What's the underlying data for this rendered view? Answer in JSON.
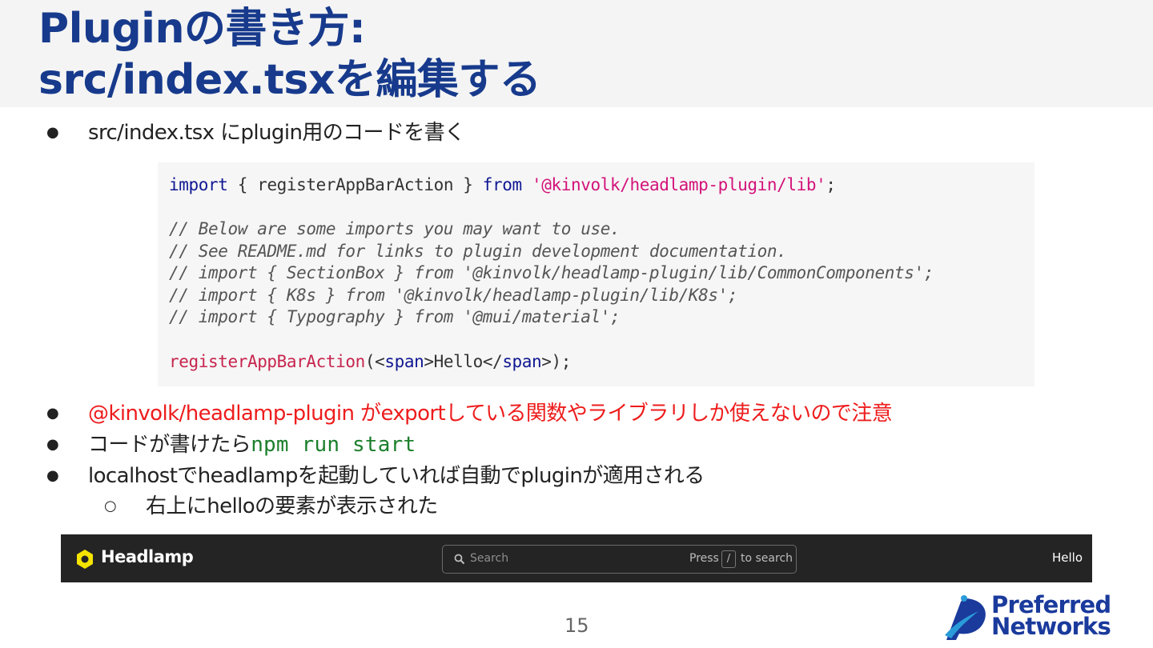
{
  "title": {
    "line1": "Pluginの書き方:",
    "line2": "src/index.tsxを編集する"
  },
  "bullets": {
    "b1": "src/index.tsx にplugin用のコードを書く",
    "b2": "@kinvolk/headlamp-plugin がexportしている関数やライブラリしか使えないので注意",
    "b3_text": "コードが書けたら",
    "b3_code": "npm run start",
    "b4": "localhostでheadlampを起動していれば自動でpluginが適用される",
    "b5": "右上にhelloの要素が表示された",
    "dot": "●",
    "sub_dot": "○"
  },
  "code": {
    "l1": {
      "kw1": "import",
      "p1": " { registerAppBarAction } ",
      "kw2": "from",
      "p2": " ",
      "str": "'@kinvolk/headlamp-plugin/lib'",
      "p3": ";"
    },
    "l3": "// Below are some imports you may want to use.",
    "l4": "//   See README.md for links to plugin development documentation.",
    "l5": "// import { SectionBox } from '@kinvolk/headlamp-plugin/lib/CommonComponents';",
    "l6": "// import { K8s } from '@kinvolk/headlamp-plugin/lib/K8s';",
    "l7": "// import { Typography } from '@mui/material';",
    "l9": {
      "fn": "registerAppBarAction",
      "p1": "(<",
      "tag1": "span",
      "p2": ">Hello</",
      "tag2": "span",
      "p3": ">);"
    }
  },
  "appbar": {
    "brand": "Headlamp",
    "search_placeholder": "Search",
    "press": "Press",
    "key": "/",
    "to_search": "to search",
    "hello": "Hello",
    "logo_color": "#f5e400"
  },
  "footer": {
    "page_number": "15",
    "brand_line1": "Preferred",
    "brand_line2": "Networks"
  }
}
